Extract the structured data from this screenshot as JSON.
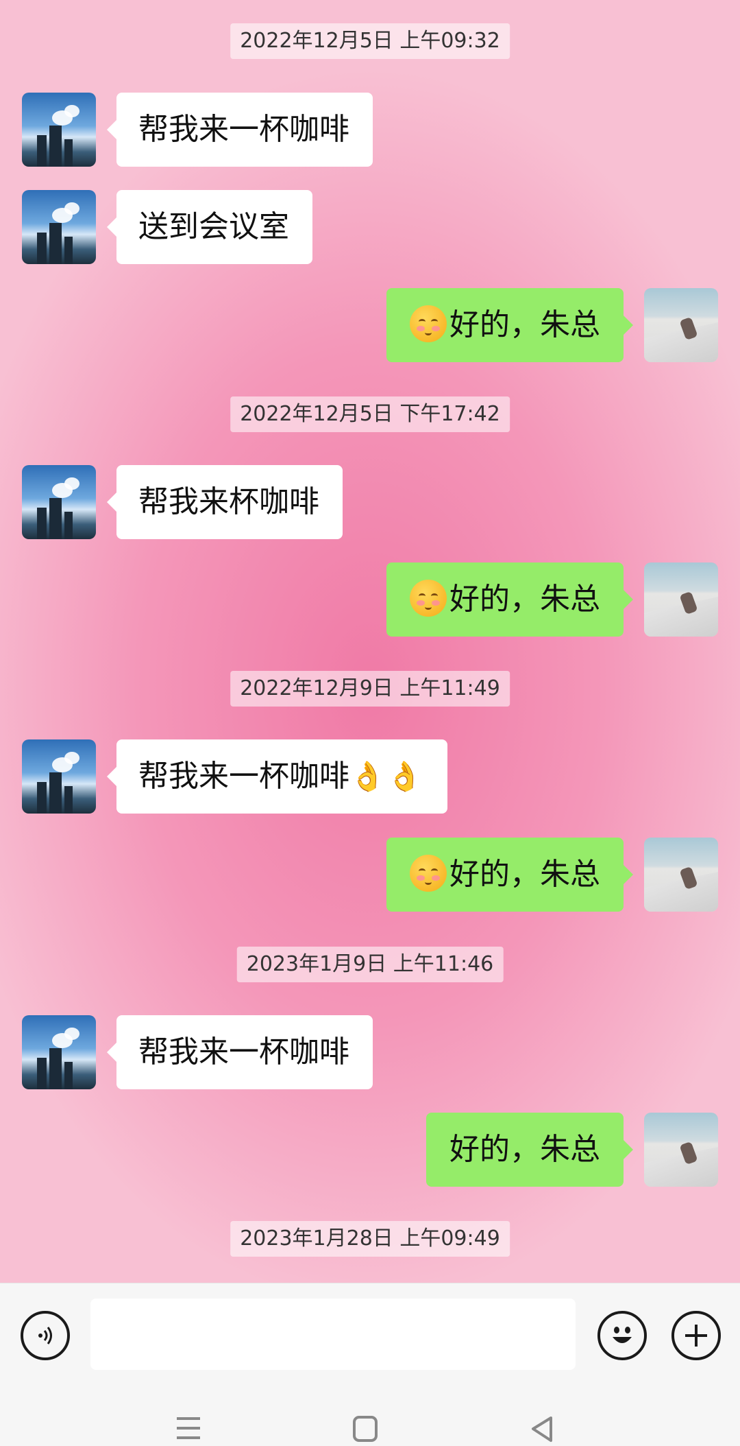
{
  "messages": [
    {
      "type": "timestamp",
      "text": "2022年12月5日 上午09:32"
    },
    {
      "type": "incoming",
      "text": "帮我来一杯咖啡"
    },
    {
      "type": "incoming",
      "text": "送到会议室"
    },
    {
      "type": "outgoing",
      "emoji": "smiling-face-icon",
      "text": "好的，朱总"
    },
    {
      "type": "timestamp",
      "text": "2022年12月5日 下午17:42"
    },
    {
      "type": "incoming",
      "text": "帮我来杯咖啡"
    },
    {
      "type": "outgoing",
      "emoji": "smiling-face-icon",
      "text": "好的，朱总"
    },
    {
      "type": "timestamp",
      "text": "2022年12月9日 上午11:49"
    },
    {
      "type": "incoming",
      "text": "帮我来一杯咖啡",
      "trailing_emoji": "👌👌"
    },
    {
      "type": "outgoing",
      "emoji": "smiling-face-icon",
      "text": "好的，朱总"
    },
    {
      "type": "timestamp",
      "text": "2023年1月9日 上午11:46"
    },
    {
      "type": "incoming",
      "text": "帮我来一杯咖啡"
    },
    {
      "type": "outgoing",
      "text": "好的，朱总"
    },
    {
      "type": "timestamp",
      "text": "2023年1月28日 上午09:49"
    }
  ],
  "input_bar": {
    "voice_icon": "voice-icon",
    "input_value": "",
    "emoji_icon": "emoji-icon",
    "plus_icon": "plus-icon"
  },
  "nav": {
    "menu_icon": "menu-icon",
    "home_icon": "home-icon",
    "back_icon": "back-icon"
  },
  "colors": {
    "outgoing_bubble": "#95ec69",
    "incoming_bubble": "#ffffff",
    "chat_background": "#f497b9"
  }
}
